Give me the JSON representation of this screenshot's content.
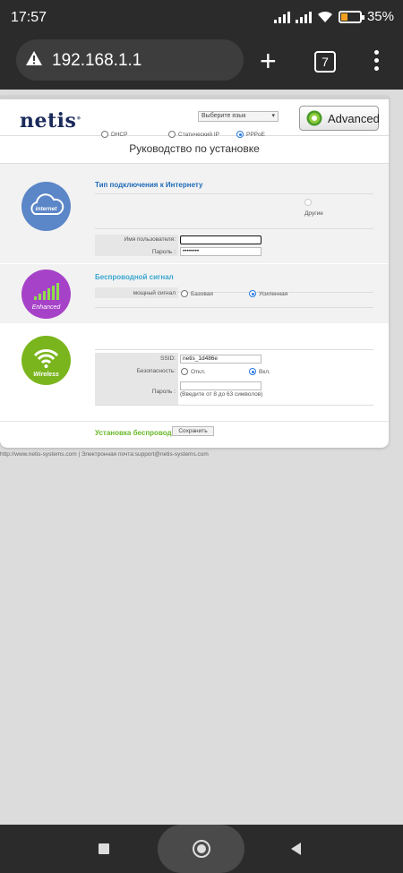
{
  "status_bar": {
    "time": "17:57",
    "battery": "35%",
    "battery_level": 0.35
  },
  "browser": {
    "url": "192.168.1.1",
    "tab_count": "7"
  },
  "header": {
    "logo": "netis",
    "language_select": "Выберите язык",
    "advanced_button": "Advanced",
    "guide_title": "Руководство по установке"
  },
  "internet": {
    "icon_label": "internet",
    "title": "Тип подключения к Интернету",
    "options": [
      {
        "label": "DHCP",
        "selected": false
      },
      {
        "label": "Статический IP",
        "selected": false
      },
      {
        "label": "PPPoE",
        "selected": true
      },
      {
        "label": "Другие",
        "selected": false
      }
    ],
    "username_label": "Имя пользователя:",
    "username_value": "",
    "password_label": "Пароль :",
    "password_value": "••••••••"
  },
  "wireless_signal": {
    "icon_label": "Enhanced",
    "title": "Беспроводной сигнал",
    "strength_label": "мощный сигнал",
    "options": [
      {
        "label": "Базовая",
        "selected": false
      },
      {
        "label": "Усиленная",
        "selected": true
      }
    ]
  },
  "wireless_setup": {
    "icon_label": "Wireless",
    "title": "Установка беспроводной связи",
    "ssid_label": "SSID:",
    "ssid_value": "netis_1d486e",
    "security_label": "Безопасность:",
    "security_options": [
      {
        "label": "Откл.",
        "selected": false
      },
      {
        "label": "Вкл.",
        "selected": true
      }
    ],
    "password_label": "Пароль :",
    "password_value": "",
    "password_hint": "(Введите от 8 до 63 символов)"
  },
  "save_button": "Сохранить",
  "footer": "http://www.netis-systems.com | Электронная почта:support@netis-systems.com",
  "colors": {
    "internet_title": "#1f6bb8",
    "signal_title": "#3aa6d0",
    "wireless_title": "#6ab82a",
    "internet_icon": "#5b86c8",
    "signal_icon": "#a642c8",
    "wireless_icon": "#7ab51d"
  }
}
